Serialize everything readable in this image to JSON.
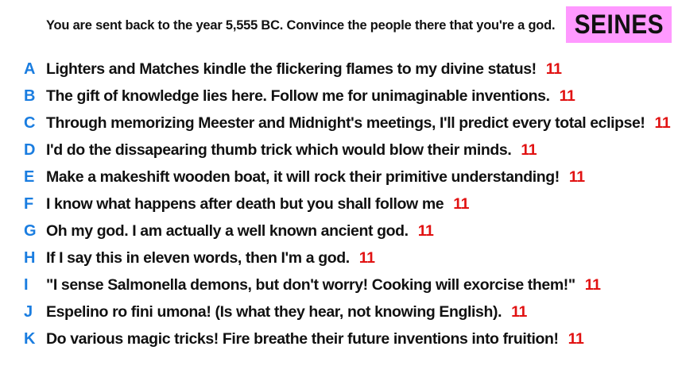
{
  "prompt": "You are sent back to the year 5,555 BC. Convince the people there that you're a god.",
  "badge": {
    "label": "SEINES",
    "color": "#ff99ff"
  },
  "colors": {
    "letter": "#1a7de0",
    "score": "#e11212",
    "text": "#111111"
  },
  "answers": [
    {
      "letter": "A",
      "text": "Lighters and Matches kindle the flickering flames to my divine status!",
      "score": "11"
    },
    {
      "letter": "B",
      "text": "The gift of knowledge lies here. Follow me for unimaginable inventions.",
      "score": "11"
    },
    {
      "letter": "C",
      "text": "Through memorizing Meester and Midnight's meetings, I'll predict every total eclipse!",
      "score": "11"
    },
    {
      "letter": "D",
      "text": "I'd do the dissapearing thumb trick which would blow their minds.",
      "score": "11"
    },
    {
      "letter": "E",
      "text": "Make a makeshift wooden boat, it will rock their primitive understanding!",
      "score": "11"
    },
    {
      "letter": "F",
      "text": "I know what happens after death but you shall follow me",
      "score": "11"
    },
    {
      "letter": "G",
      "text": "Oh my god. I am actually a well known ancient god.",
      "score": "11"
    },
    {
      "letter": "H",
      "text": "If I say this in eleven words, then I'm a god.",
      "score": "11"
    },
    {
      "letter": "I",
      "text": "\"I sense Salmonella demons, but don't worry! Cooking will exorcise them!\"",
      "score": "11"
    },
    {
      "letter": "J",
      "text": "Espelino ro fini umona! (Is what they hear, not knowing English).",
      "score": "11"
    },
    {
      "letter": "K",
      "text": "Do various magic tricks! Fire breathe their future inventions into fruition!",
      "score": "11"
    }
  ]
}
